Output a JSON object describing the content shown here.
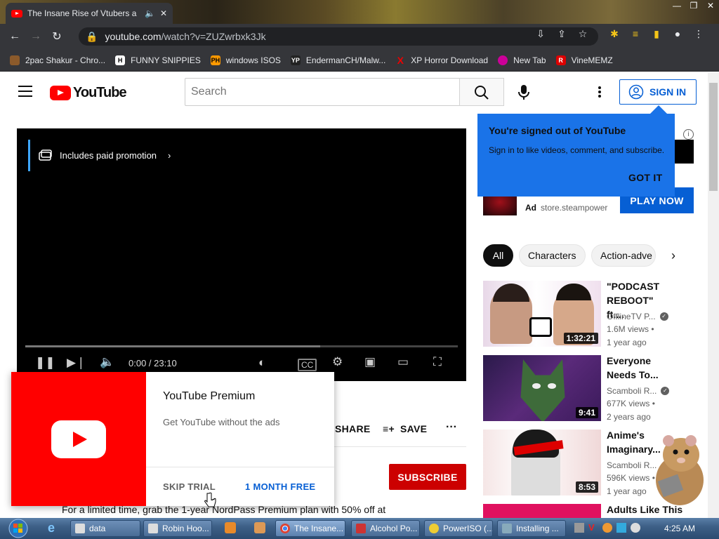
{
  "browser": {
    "tab_title": "The Insane Rise of Vtubers a",
    "url_domain": "youtube.com",
    "url_path": "/watch?v=ZUZwrbxk3Jk",
    "bookmarks": [
      {
        "label": "2pac Shakur - Chro...",
        "icon": "2pac-icon"
      },
      {
        "label": "FUNNY SNIPPIES",
        "icon": "h-icon"
      },
      {
        "label": "windows ISOS",
        "icon": "ph-icon"
      },
      {
        "label": "EndermanCH/Malw...",
        "icon": "yp-icon"
      },
      {
        "label": "XP Horror Download",
        "icon": "x-icon"
      },
      {
        "label": "New Tab",
        "icon": "newtab-icon"
      },
      {
        "label": "VineMEMZ",
        "icon": "r-icon"
      }
    ]
  },
  "youtube": {
    "logo_text": "YouTube",
    "search_placeholder": "Search",
    "sign_in_label": "SIGN IN"
  },
  "player": {
    "promo_label": "Includes paid promotion",
    "time": "0:00 / 23:10"
  },
  "premium_popup": {
    "title": "YouTube Premium",
    "subtitle": "Get YouTube without the ads",
    "skip_label": "SKIP TRIAL",
    "month_label": "1 MONTH FREE"
  },
  "actions": {
    "share_label": "SHARE",
    "save_label": "SAVE",
    "subscribe_label": "SUBSCRIBE"
  },
  "description_line": "For a limited time, grab the 1-year NordPass Premium plan with 50% off at",
  "signin_tip": {
    "title": "You're signed out of YouTube",
    "body": "Sign in to like videos, comment, and subscribe.",
    "got_it": "GOT IT"
  },
  "ad": {
    "ad_label": "Ad",
    "domain": "store.steampower",
    "cta": "PLAY NOW"
  },
  "chips": [
    "All",
    "Characters",
    "Action-adve"
  ],
  "recommendations": [
    {
      "title": "\"PODCAST REBOOT\" ft....",
      "channel": "OfflineTV P...",
      "views": "1.6M views",
      "age": "1 year ago",
      "duration": "1:32:21"
    },
    {
      "title": "Everyone Needs To...",
      "channel": "Scamboli R...",
      "views": "677K views",
      "age": "2 years ago",
      "duration": "9:41"
    },
    {
      "title": "Anime's Imaginary...",
      "channel": "Scamboli R...",
      "views": "596K views",
      "age": "1 year ago",
      "duration": "8:53"
    },
    {
      "title": "Adults Like This"
    }
  ],
  "taskbar": {
    "items": [
      "data",
      "Robin Hoo...",
      "The Insane...",
      "Alcohol Po...",
      "PowerISO (...",
      "Installing ..."
    ],
    "clock": "4:25 AM"
  }
}
